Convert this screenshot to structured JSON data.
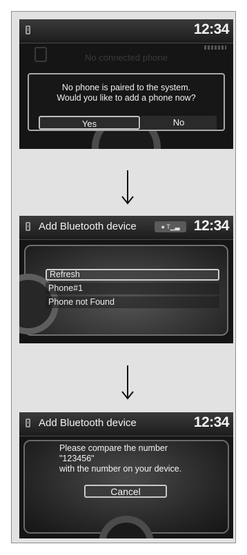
{
  "screen1": {
    "clock": "12:34",
    "background_text": "No connected phone",
    "dialog": {
      "message_line1": "No phone is paired to the system.",
      "message_line2": "Would you like to add a phone now?",
      "yes_label": "Yes",
      "no_label": "No"
    },
    "icons": [
      "phone-icon",
      "signal-icon"
    ]
  },
  "screen2": {
    "title": "Add Bluetooth device",
    "clock": "12:34",
    "list_items": [
      {
        "label": "Refresh",
        "selected": true
      },
      {
        "label": "Phone#1",
        "selected": false
      },
      {
        "label": "Phone not Found",
        "selected": false
      }
    ],
    "icons": [
      "phone-icon",
      "bluetooth-status-icon"
    ]
  },
  "screen3": {
    "title": "Add Bluetooth device",
    "clock": "12:34",
    "message_line1": "Please compare the number",
    "message_line2": "\"123456\"",
    "message_line3": "with the number on your device.",
    "cancel_label": "Cancel",
    "icons": [
      "phone-icon"
    ]
  },
  "arrows": [
    "down-arrow-icon",
    "down-arrow-icon"
  ],
  "colors": {
    "screen_bg": "#151515",
    "frame_bg": "#e2e2e2",
    "highlight_border": "#cfcfcf"
  }
}
